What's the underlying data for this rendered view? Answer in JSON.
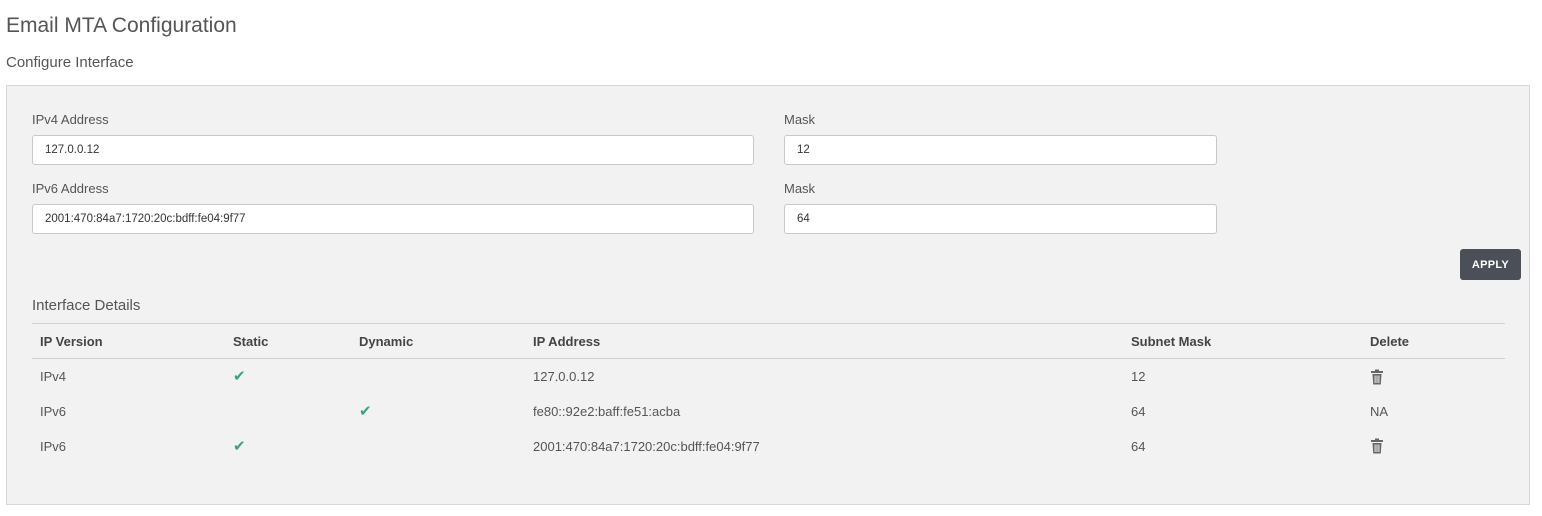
{
  "page": {
    "title": "Email MTA Configuration",
    "section_title": "Configure Interface"
  },
  "form": {
    "ipv4_label": "IPv4 Address",
    "ipv4_value": "127.0.0.12",
    "ipv4_mask_label": "Mask",
    "ipv4_mask_value": "12",
    "ipv6_label": "IPv6 Address",
    "ipv6_value": "2001:470:84a7:1720:20c:bdff:fe04:9f77",
    "ipv6_mask_label": "Mask",
    "ipv6_mask_value": "64",
    "apply_label": "APPLY"
  },
  "details": {
    "title": "Interface Details",
    "columns": [
      "IP Version",
      "Static",
      "Dynamic",
      "IP Address",
      "Subnet Mask",
      "Delete"
    ],
    "rows": [
      {
        "version": "IPv4",
        "static": true,
        "dynamic": false,
        "ip": "127.0.0.12",
        "mask": "12",
        "delete": "trash-icon"
      },
      {
        "version": "IPv6",
        "static": false,
        "dynamic": true,
        "ip": "fe80::92e2:baff:fe51:acba",
        "mask": "64",
        "delete": "NA"
      },
      {
        "version": "IPv6",
        "static": true,
        "dynamic": false,
        "ip": "2001:470:84a7:1720:20c:bdff:fe04:9f77",
        "mask": "64",
        "delete": "trash-icon"
      }
    ]
  },
  "icons": {
    "check": "check-icon",
    "trash": "trash-icon"
  },
  "colors": {
    "check": "#3aa37a",
    "apply_button": "#4a4f58",
    "panel_bg": "#f2f2f2"
  }
}
